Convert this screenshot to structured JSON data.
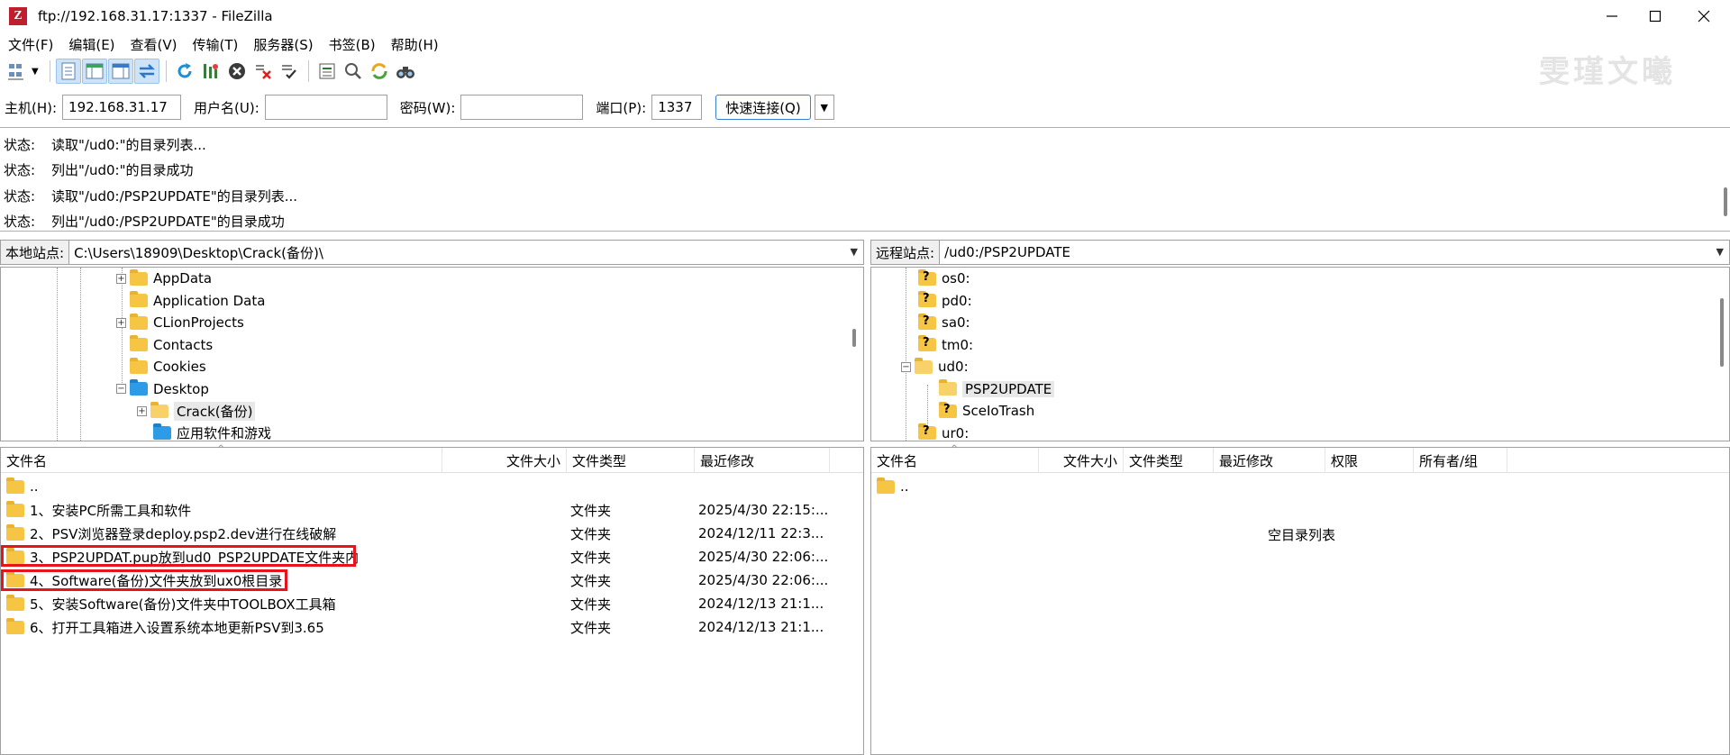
{
  "window": {
    "title": "ftp://192.168.31.17:1337 - FileZilla",
    "icon_letter": "Z"
  },
  "menu": [
    {
      "label": "文件(F)"
    },
    {
      "label": "编辑(E)"
    },
    {
      "label": "查看(V)"
    },
    {
      "label": "传输(T)"
    },
    {
      "label": "服务器(S)"
    },
    {
      "label": "书签(B)"
    },
    {
      "label": "帮助(H)"
    }
  ],
  "watermark": "雯瑾文曦",
  "quickconnect": {
    "host_label": "主机(H):",
    "host_value": "192.168.31.17",
    "user_label": "用户名(U):",
    "user_value": "",
    "pass_label": "密码(W):",
    "pass_value": "",
    "port_label": "端口(P):",
    "port_value": "1337",
    "connect_label": "快速连接(Q)"
  },
  "log": [
    {
      "label": "状态:",
      "text": "读取\"/ud0:\"的目录列表..."
    },
    {
      "label": "状态:",
      "text": "列出\"/ud0:\"的目录成功"
    },
    {
      "label": "状态:",
      "text": "读取\"/ud0:/PSP2UPDATE\"的目录列表..."
    },
    {
      "label": "状态:",
      "text": "列出\"/ud0:/PSP2UPDATE\"的目录成功"
    }
  ],
  "local": {
    "site_label": "本地站点:",
    "path": "C:\\Users\\18909\\Desktop\\Crack(备份)\\",
    "tree": [
      {
        "label": "AppData",
        "expander": "+"
      },
      {
        "label": "Application Data",
        "expander": ""
      },
      {
        "label": "CLionProjects",
        "expander": "+"
      },
      {
        "label": "Contacts",
        "expander": ""
      },
      {
        "label": "Cookies",
        "expander": ""
      },
      {
        "label": "Desktop",
        "expander": "−"
      },
      {
        "label": "Crack(备份)",
        "expander": "+"
      },
      {
        "label": "应用软件和游戏",
        "expander": ""
      }
    ],
    "columns": {
      "name": "文件名",
      "size": "文件大小",
      "type": "文件类型",
      "modified": "最近修改"
    },
    "files": [
      {
        "name": "..",
        "type": "",
        "modified": ""
      },
      {
        "name": "1、安装PC所需工具和软件",
        "type": "文件夹",
        "modified": "2025/4/30 22:15:..."
      },
      {
        "name": "2、PSV浏览器登录deploy.psp2.dev进行在线破解",
        "type": "文件夹",
        "modified": "2024/12/11 22:3..."
      },
      {
        "name": "3、PSP2UPDAT.pup放到ud0_PSP2UPDATE文件夹内",
        "type": "文件夹",
        "modified": "2025/4/30 22:06:..."
      },
      {
        "name": "4、Software(备份)文件夹放到ux0根目录",
        "type": "文件夹",
        "modified": "2025/4/30 22:06:..."
      },
      {
        "name": "5、安装Software(备份)文件夹中TOOLBOX工具箱",
        "type": "文件夹",
        "modified": "2024/12/13 21:1..."
      },
      {
        "name": "6、打开工具箱进入设置系统本地更新PSV到3.65",
        "type": "文件夹",
        "modified": "2024/12/13 21:1..."
      }
    ]
  },
  "remote": {
    "site_label": "远程站点:",
    "path": "/ud0:/PSP2UPDATE",
    "tree": [
      {
        "label": "os0:",
        "expander": ""
      },
      {
        "label": "pd0:",
        "expander": ""
      },
      {
        "label": "sa0:",
        "expander": ""
      },
      {
        "label": "tm0:",
        "expander": ""
      },
      {
        "label": "ud0:",
        "expander": "−"
      },
      {
        "label": "PSP2UPDATE",
        "expander": ""
      },
      {
        "label": "SceIoTrash",
        "expander": ""
      },
      {
        "label": "ur0:",
        "expander": ""
      }
    ],
    "columns": {
      "name": "文件名",
      "size": "文件大小",
      "type": "文件类型",
      "modified": "最近修改",
      "perms": "权限",
      "owner": "所有者/组"
    },
    "files": [
      {
        "name": ".."
      }
    ],
    "empty_message": "空目录列表"
  }
}
